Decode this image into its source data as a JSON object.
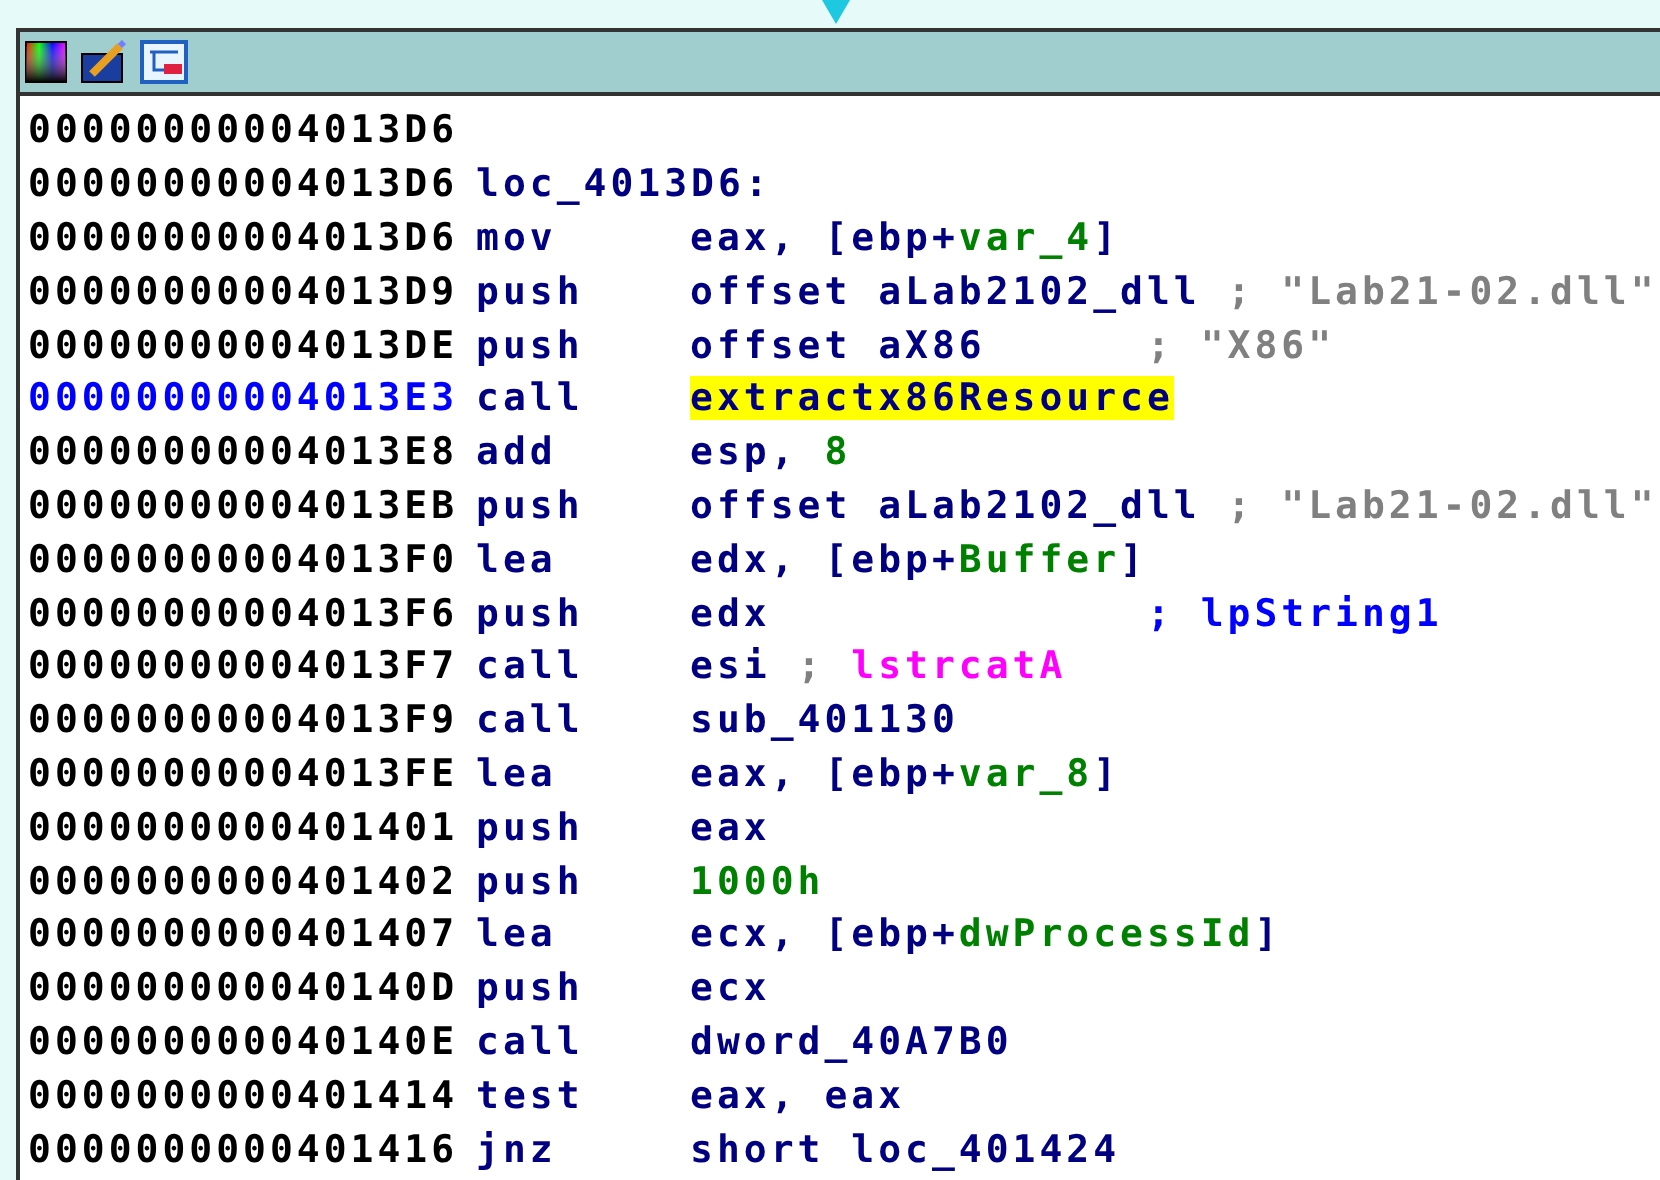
{
  "listing": [
    {
      "kind": "blank",
      "address": "00000000004013D6",
      "selected": false
    },
    {
      "kind": "label",
      "address": "00000000004013D6",
      "label": "loc_4013D6:",
      "selected": false
    },
    {
      "kind": "insn",
      "address": "00000000004013D6",
      "mnemonic": "mov",
      "operand": [
        {
          "text": "eax, [ebp+",
          "kind": "plain"
        },
        {
          "text": "var_4",
          "kind": "var"
        },
        {
          "text": "]",
          "kind": "plain"
        }
      ],
      "selected": false
    },
    {
      "kind": "insn",
      "address": "00000000004013D9",
      "mnemonic": "push",
      "operand": [
        {
          "text": "offset aLab2102_dll ",
          "kind": "plain"
        },
        {
          "text": "; \"Lab21-02.dll\"",
          "kind": "comment"
        }
      ],
      "selected": false
    },
    {
      "kind": "insn",
      "address": "00000000004013DE",
      "mnemonic": "push",
      "operand": [
        {
          "text": "offset aX86      ",
          "kind": "plain"
        },
        {
          "text": "; \"X86\"",
          "kind": "comment"
        }
      ],
      "selected": false
    },
    {
      "kind": "insn",
      "address": "00000000004013E3",
      "mnemonic": "call",
      "operand": [
        {
          "text": "extractx86Resource",
          "kind": "highlight"
        }
      ],
      "selected": true
    },
    {
      "kind": "insn",
      "address": "00000000004013E8",
      "mnemonic": "add",
      "operand": [
        {
          "text": "esp, ",
          "kind": "plain"
        },
        {
          "text": "8",
          "kind": "var"
        }
      ],
      "selected": false
    },
    {
      "kind": "insn",
      "address": "00000000004013EB",
      "mnemonic": "push",
      "operand": [
        {
          "text": "offset aLab2102_dll ",
          "kind": "plain"
        },
        {
          "text": "; \"Lab21-02.dll\"",
          "kind": "comment"
        }
      ],
      "selected": false
    },
    {
      "kind": "insn",
      "address": "00000000004013F0",
      "mnemonic": "lea",
      "operand": [
        {
          "text": "edx, [ebp+",
          "kind": "plain"
        },
        {
          "text": "Buffer",
          "kind": "var"
        },
        {
          "text": "]",
          "kind": "plain"
        }
      ],
      "selected": false
    },
    {
      "kind": "insn",
      "address": "00000000004013F6",
      "mnemonic": "push",
      "operand": [
        {
          "text": "edx              ",
          "kind": "plain"
        },
        {
          "text": "; lpString1",
          "kind": "comment-name"
        }
      ],
      "selected": false
    },
    {
      "kind": "insn",
      "address": "00000000004013F7",
      "mnemonic": "call",
      "operand": [
        {
          "text": "esi ",
          "kind": "plain"
        },
        {
          "text": "; ",
          "kind": "comment"
        },
        {
          "text": "lstrcatA",
          "kind": "import"
        }
      ],
      "selected": false
    },
    {
      "kind": "insn",
      "address": "00000000004013F9",
      "mnemonic": "call",
      "operand": [
        {
          "text": "sub_401130",
          "kind": "plain"
        }
      ],
      "selected": false
    },
    {
      "kind": "insn",
      "address": "00000000004013FE",
      "mnemonic": "lea",
      "operand": [
        {
          "text": "eax, [ebp+",
          "kind": "plain"
        },
        {
          "text": "var_8",
          "kind": "var"
        },
        {
          "text": "]",
          "kind": "plain"
        }
      ],
      "selected": false
    },
    {
      "kind": "insn",
      "address": "0000000000401401",
      "mnemonic": "push",
      "operand": [
        {
          "text": "eax",
          "kind": "plain"
        }
      ],
      "selected": false
    },
    {
      "kind": "insn",
      "address": "0000000000401402",
      "mnemonic": "push",
      "operand": [
        {
          "text": "1000h",
          "kind": "var"
        }
      ],
      "selected": false
    },
    {
      "kind": "insn",
      "address": "0000000000401407",
      "mnemonic": "lea",
      "operand": [
        {
          "text": "ecx, [ebp+",
          "kind": "plain"
        },
        {
          "text": "dwProcessId",
          "kind": "var"
        },
        {
          "text": "]",
          "kind": "plain"
        }
      ],
      "selected": false
    },
    {
      "kind": "insn",
      "address": "000000000040140D",
      "mnemonic": "push",
      "operand": [
        {
          "text": "ecx",
          "kind": "plain"
        }
      ],
      "selected": false
    },
    {
      "kind": "insn",
      "address": "000000000040140E",
      "mnemonic": "call",
      "operand": [
        {
          "text": "dword_40A7B0",
          "kind": "plain"
        }
      ],
      "selected": false
    },
    {
      "kind": "insn",
      "address": "0000000000401414",
      "mnemonic": "test",
      "operand": [
        {
          "text": "eax, eax",
          "kind": "plain"
        }
      ],
      "selected": false
    },
    {
      "kind": "insn",
      "address": "0000000000401416",
      "mnemonic": "jnz",
      "operand": [
        {
          "text": "short loc_401424",
          "kind": "plain"
        }
      ],
      "selected": false
    }
  ]
}
